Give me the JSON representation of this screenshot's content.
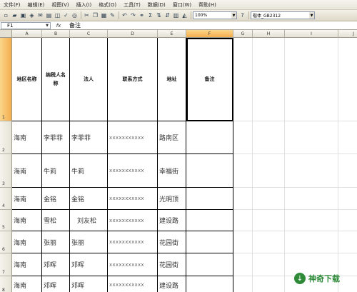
{
  "menu": {
    "items": [
      "文件(F)",
      "编辑(E)",
      "视图(V)",
      "插入(I)",
      "格式(O)",
      "工具(T)",
      "数据(D)",
      "窗口(W)",
      "帮助(H)"
    ]
  },
  "toolbar": {
    "zoom": "100%",
    "font": "楷体_GB2312",
    "sigma": "Σ"
  },
  "formula_bar": {
    "name_box": "F1",
    "fx": "fx",
    "content": "备注"
  },
  "columns": [
    "A",
    "B",
    "C",
    "D",
    "E",
    "F",
    "G",
    "H",
    "I",
    "J"
  ],
  "rows": [
    "1",
    "2",
    "3",
    "4",
    "5",
    "6",
    "7",
    "8"
  ],
  "header_row": [
    "地区名称",
    "纳税人名称",
    "法人",
    "联系方式",
    "地址",
    "备注"
  ],
  "data_rows": [
    [
      "海南",
      "李菲菲",
      "李菲菲",
      "xxxxxxxxxxx",
      "路南区",
      ""
    ],
    [
      "海南",
      "牛莉",
      "牛莉",
      "xxxxxxxxxxx",
      "幸福街",
      ""
    ],
    [
      "海南",
      "金铭",
      "金铭",
      "xxxxxxxxxxx",
      "光明顶",
      ""
    ],
    [
      "海南",
      "雪松",
      "刘友松",
      "xxxxxxxxxxx",
      "建设路",
      ""
    ],
    [
      "海南",
      "张丽",
      "张丽",
      "xxxxxxxxxxx",
      "花园街",
      ""
    ],
    [
      "海南",
      "邓晖",
      "邓晖",
      "xxxxxxxxxxx",
      "花园街",
      ""
    ],
    [
      "海南",
      "邓晖",
      "邓晖",
      "xxxxxxxxxxx",
      "建设路",
      ""
    ]
  ],
  "watermark": {
    "text": "神奇下载",
    "color": "#2f8a3a"
  }
}
